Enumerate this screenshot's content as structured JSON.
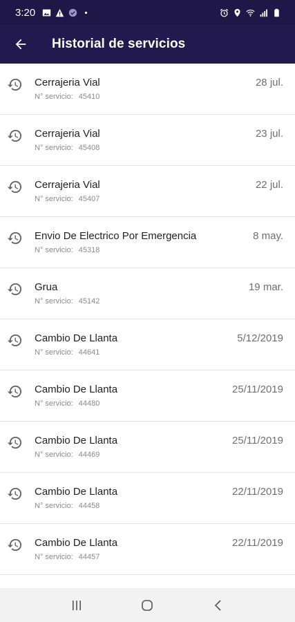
{
  "status_bar": {
    "time": "3:20",
    "left_icons": [
      "gallery-icon",
      "alert-icon",
      "check-circle-icon",
      "dot-icon"
    ],
    "right_icons": [
      "alarm-icon",
      "location-icon",
      "wifi-icon",
      "signal-icon",
      "battery-icon"
    ]
  },
  "app_bar": {
    "title": "Historial de servicios",
    "back_icon": "arrow-left-icon",
    "background": "#22194e"
  },
  "list": {
    "service_prefix": "N° servicio:",
    "items": [
      {
        "name": "Cerrajeria Vial",
        "number": "45410",
        "date": "28 jul."
      },
      {
        "name": "Cerrajeria Vial",
        "number": "45408",
        "date": "23 jul."
      },
      {
        "name": "Cerrajeria Vial",
        "number": "45407",
        "date": "22 jul."
      },
      {
        "name": "Envio De Electrico Por Emergencia",
        "number": "45318",
        "date": "8 may."
      },
      {
        "name": "Grua",
        "number": "45142",
        "date": "19 mar."
      },
      {
        "name": "Cambio De Llanta",
        "number": "44641",
        "date": "5/12/2019"
      },
      {
        "name": "Cambio De Llanta",
        "number": "44480",
        "date": "25/11/2019"
      },
      {
        "name": "Cambio De Llanta",
        "number": "44469",
        "date": "25/11/2019"
      },
      {
        "name": "Cambio De Llanta",
        "number": "44458",
        "date": "22/11/2019"
      },
      {
        "name": "Cambio De Llanta",
        "number": "44457",
        "date": "22/11/2019"
      }
    ]
  },
  "nav_bar": {
    "buttons": [
      "recents-icon",
      "home-icon",
      "back-icon"
    ]
  }
}
